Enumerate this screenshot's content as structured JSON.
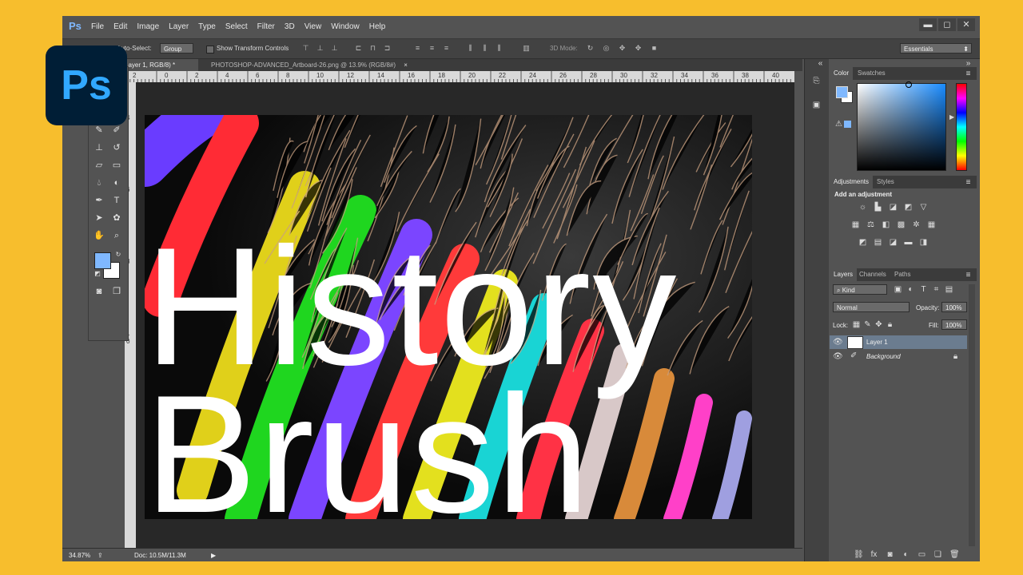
{
  "app": {
    "logo_text": "Ps",
    "mini_logo": "Ps"
  },
  "menu": [
    "File",
    "Edit",
    "Image",
    "Layer",
    "Type",
    "Select",
    "Filter",
    "3D",
    "View",
    "Window",
    "Help"
  ],
  "window_controls": [
    "▬",
    "◻",
    "✕"
  ],
  "options_bar": {
    "auto_select_label": "Auto-Select:",
    "auto_select_value": "Group",
    "show_transform_label": "Show Transform Controls",
    "mode_3d_label": "3D Mode:",
    "workspace": "Essentials"
  },
  "tabs": {
    "active": "% (Layer 1, RGB/8) *",
    "inactive": "PHOTOSHOP-ADVANCED_Artboard-26.png @ 13.9% (RGB/8#)",
    "close": "×"
  },
  "ruler": {
    "h_labels": [
      "2",
      "0",
      "2",
      "4",
      "6",
      "8",
      "10",
      "12",
      "14",
      "16",
      "18",
      "20",
      "22",
      "24",
      "26",
      "28",
      "30",
      "32",
      "34",
      "36",
      "38",
      "40"
    ],
    "v_labels": [
      "4",
      "6",
      "8",
      "1",
      "0"
    ]
  },
  "canvas_text": {
    "line1": "History",
    "line2": "Brush"
  },
  "status": {
    "zoom": "34.87%",
    "doc": "Doc: 10.5M/11.3M"
  },
  "panels": {
    "color_tabs": [
      "Color",
      "Swatches"
    ],
    "adjust_tabs": [
      "Adjustments",
      "Styles"
    ],
    "add_adjustment": "Add an adjustment",
    "layers_tabs": [
      "Layers",
      "Channels",
      "Paths"
    ],
    "kind_label": "Kind",
    "blend_mode": "Normal",
    "opacity_label": "Opacity:",
    "opacity_value": "100%",
    "lock_label": "Lock:",
    "fill_label": "Fill:",
    "fill_value": "100%",
    "layers": [
      {
        "name": "Layer 1",
        "selected": true
      },
      {
        "name": "Background",
        "selected": false
      }
    ]
  },
  "colors": {
    "accent": "#7fb8ff",
    "background": "#f7be2d",
    "ps_logo_bg": "#001e36"
  }
}
